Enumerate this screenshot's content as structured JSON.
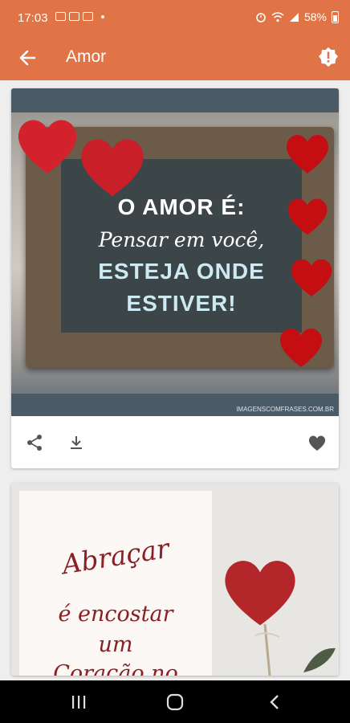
{
  "status_bar": {
    "time": "17:03",
    "battery": "58%",
    "icons_left": [
      "sim-icon",
      "gallery-icon",
      "youtube-icon"
    ],
    "icons_right": [
      "alarm-icon",
      "wifi-icon",
      "signal-icon",
      "battery-icon"
    ]
  },
  "app_bar": {
    "title": "Amor",
    "back_icon": "arrow-left-icon",
    "report_icon": "alert-icon",
    "color": "#e07446"
  },
  "cards": [
    {
      "text_lines": [
        "O AMOR É:",
        "Pensar em você,",
        "ESTEJA ONDE",
        "ESTIVER!"
      ],
      "watermark": "IMAGENSCOMFRASES.COM.BR",
      "actions": [
        "share-icon",
        "download-icon",
        "favorite-icon"
      ]
    },
    {
      "text_lines": [
        "Abraçar",
        "é encostar",
        "um",
        "Coração no"
      ]
    }
  ],
  "nav_bar": {
    "buttons": [
      "recents-icon",
      "home-icon",
      "back-icon"
    ]
  }
}
